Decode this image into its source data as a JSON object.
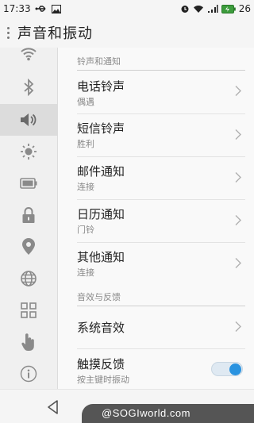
{
  "status_bar": {
    "time": "17:33",
    "battery_level": "26",
    "icons": [
      "usb-icon",
      "image-icon",
      "alarm-icon",
      "wifi-icon",
      "signal-icon",
      "battery-icon"
    ]
  },
  "header": {
    "title": "声音和振动"
  },
  "sidebar": {
    "items": [
      {
        "icon": "wifi-icon"
      },
      {
        "icon": "bluetooth-icon"
      },
      {
        "icon": "sound-icon",
        "active": true
      },
      {
        "icon": "brightness-icon"
      },
      {
        "icon": "battery-icon"
      },
      {
        "icon": "lock-icon"
      },
      {
        "icon": "location-icon"
      },
      {
        "icon": "globe-icon"
      },
      {
        "icon": "apps-grid-icon"
      },
      {
        "icon": "gesture-hand-icon"
      },
      {
        "icon": "info-icon"
      }
    ]
  },
  "sections": {
    "ringtones": {
      "header": "铃声和通知",
      "rows": [
        {
          "title": "电话铃声",
          "subtitle": "偶遇"
        },
        {
          "title": "短信铃声",
          "subtitle": "胜利"
        },
        {
          "title": "邮件通知",
          "subtitle": "连接"
        },
        {
          "title": "日历通知",
          "subtitle": "门铃"
        },
        {
          "title": "其他通知",
          "subtitle": "连接"
        }
      ]
    },
    "feedback": {
      "header": "音效与反馈",
      "rows": [
        {
          "title": "系统音效"
        },
        {
          "title": "触摸反馈",
          "subtitle": "按主键时振动",
          "toggle_on": true
        }
      ]
    }
  },
  "watermark": "@SOGIworld.com",
  "colors": {
    "accent": "#2a93e0",
    "active_sidebar": "#dcdcdc"
  }
}
